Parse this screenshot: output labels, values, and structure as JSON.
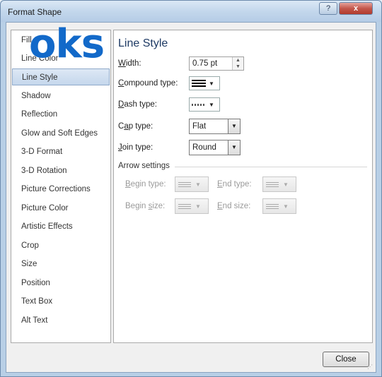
{
  "window": {
    "title": "Format Shape",
    "help": "?",
    "close": "x"
  },
  "watermark": {
    "text": "oks"
  },
  "nav": {
    "items": [
      {
        "label": "Fill"
      },
      {
        "label": "Line Color"
      },
      {
        "label": "Line Style"
      },
      {
        "label": "Shadow"
      },
      {
        "label": "Reflection"
      },
      {
        "label": "Glow and Soft Edges"
      },
      {
        "label": "3-D Format"
      },
      {
        "label": "3-D Rotation"
      },
      {
        "label": "Picture Corrections"
      },
      {
        "label": "Picture Color"
      },
      {
        "label": "Artistic Effects"
      },
      {
        "label": "Crop"
      },
      {
        "label": "Size"
      },
      {
        "label": "Position"
      },
      {
        "label": "Text Box"
      },
      {
        "label": "Alt Text"
      }
    ],
    "selected_index": 2
  },
  "panel": {
    "heading": "Line Style",
    "width": {
      "label_pre": "",
      "label_u": "W",
      "label_post": "idth:",
      "value": "0.75 pt"
    },
    "compound": {
      "label_u": "C",
      "label_post": "ompound type:"
    },
    "dash": {
      "label_u": "D",
      "label_post": "ash type:"
    },
    "cap": {
      "label_pre": "C",
      "label_u": "a",
      "label_post": "p type:",
      "value": "Flat"
    },
    "join": {
      "label_u": "J",
      "label_post": "oin type:",
      "value": "Round"
    },
    "arrow_section": "Arrow settings",
    "begin_type": {
      "label_u": "B",
      "label_post": "egin type:"
    },
    "end_type": {
      "label_u": "E",
      "label_post": "nd type:"
    },
    "begin_size": {
      "label_pre": "Begin ",
      "label_u": "s",
      "label_post": "ize:"
    },
    "end_size": {
      "label_u": "E",
      "label_post": "nd size:"
    }
  },
  "footer": {
    "close_label": "Close"
  }
}
